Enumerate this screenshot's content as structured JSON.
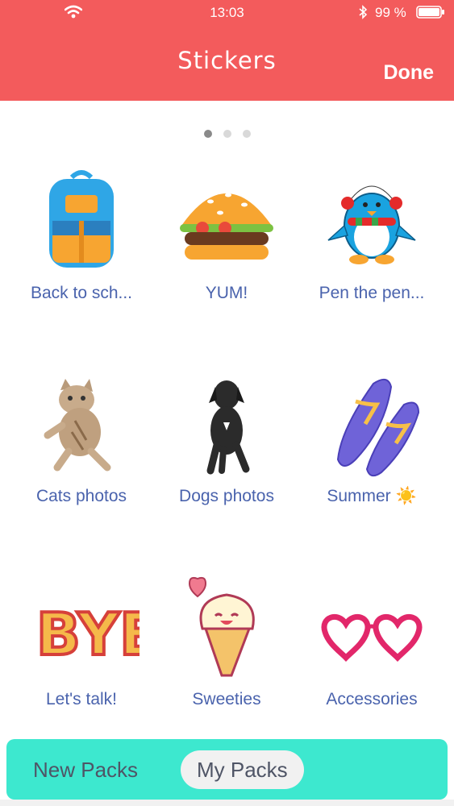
{
  "status_bar": {
    "time": "13:03",
    "battery": "99 %"
  },
  "header": {
    "title": "Stickers",
    "done_label": "Done"
  },
  "pager": {
    "pages": 3,
    "active": 0
  },
  "packs": [
    {
      "label": "Back to sch...",
      "icon": "backpack-icon"
    },
    {
      "label": "YUM!",
      "icon": "burger-icon"
    },
    {
      "label": "Pen the pen...",
      "icon": "penguin-icon"
    },
    {
      "label": "Cats photos",
      "icon": "cat-icon"
    },
    {
      "label": "Dogs photos",
      "icon": "dog-icon"
    },
    {
      "label": "Summer ☀️",
      "icon": "flip-flops-icon"
    },
    {
      "label": "Let's talk!",
      "icon": "bye-text-icon"
    },
    {
      "label": "Sweeties",
      "icon": "ice-cream-icon"
    },
    {
      "label": "Accessories",
      "icon": "heart-glasses-icon"
    }
  ],
  "tabs": {
    "new_packs": "New Packs",
    "my_packs": "My Packs",
    "selected": "my_packs"
  },
  "colors": {
    "header": "#f35b5c",
    "tabbar": "#3de8cf",
    "label": "#4a63ad"
  }
}
